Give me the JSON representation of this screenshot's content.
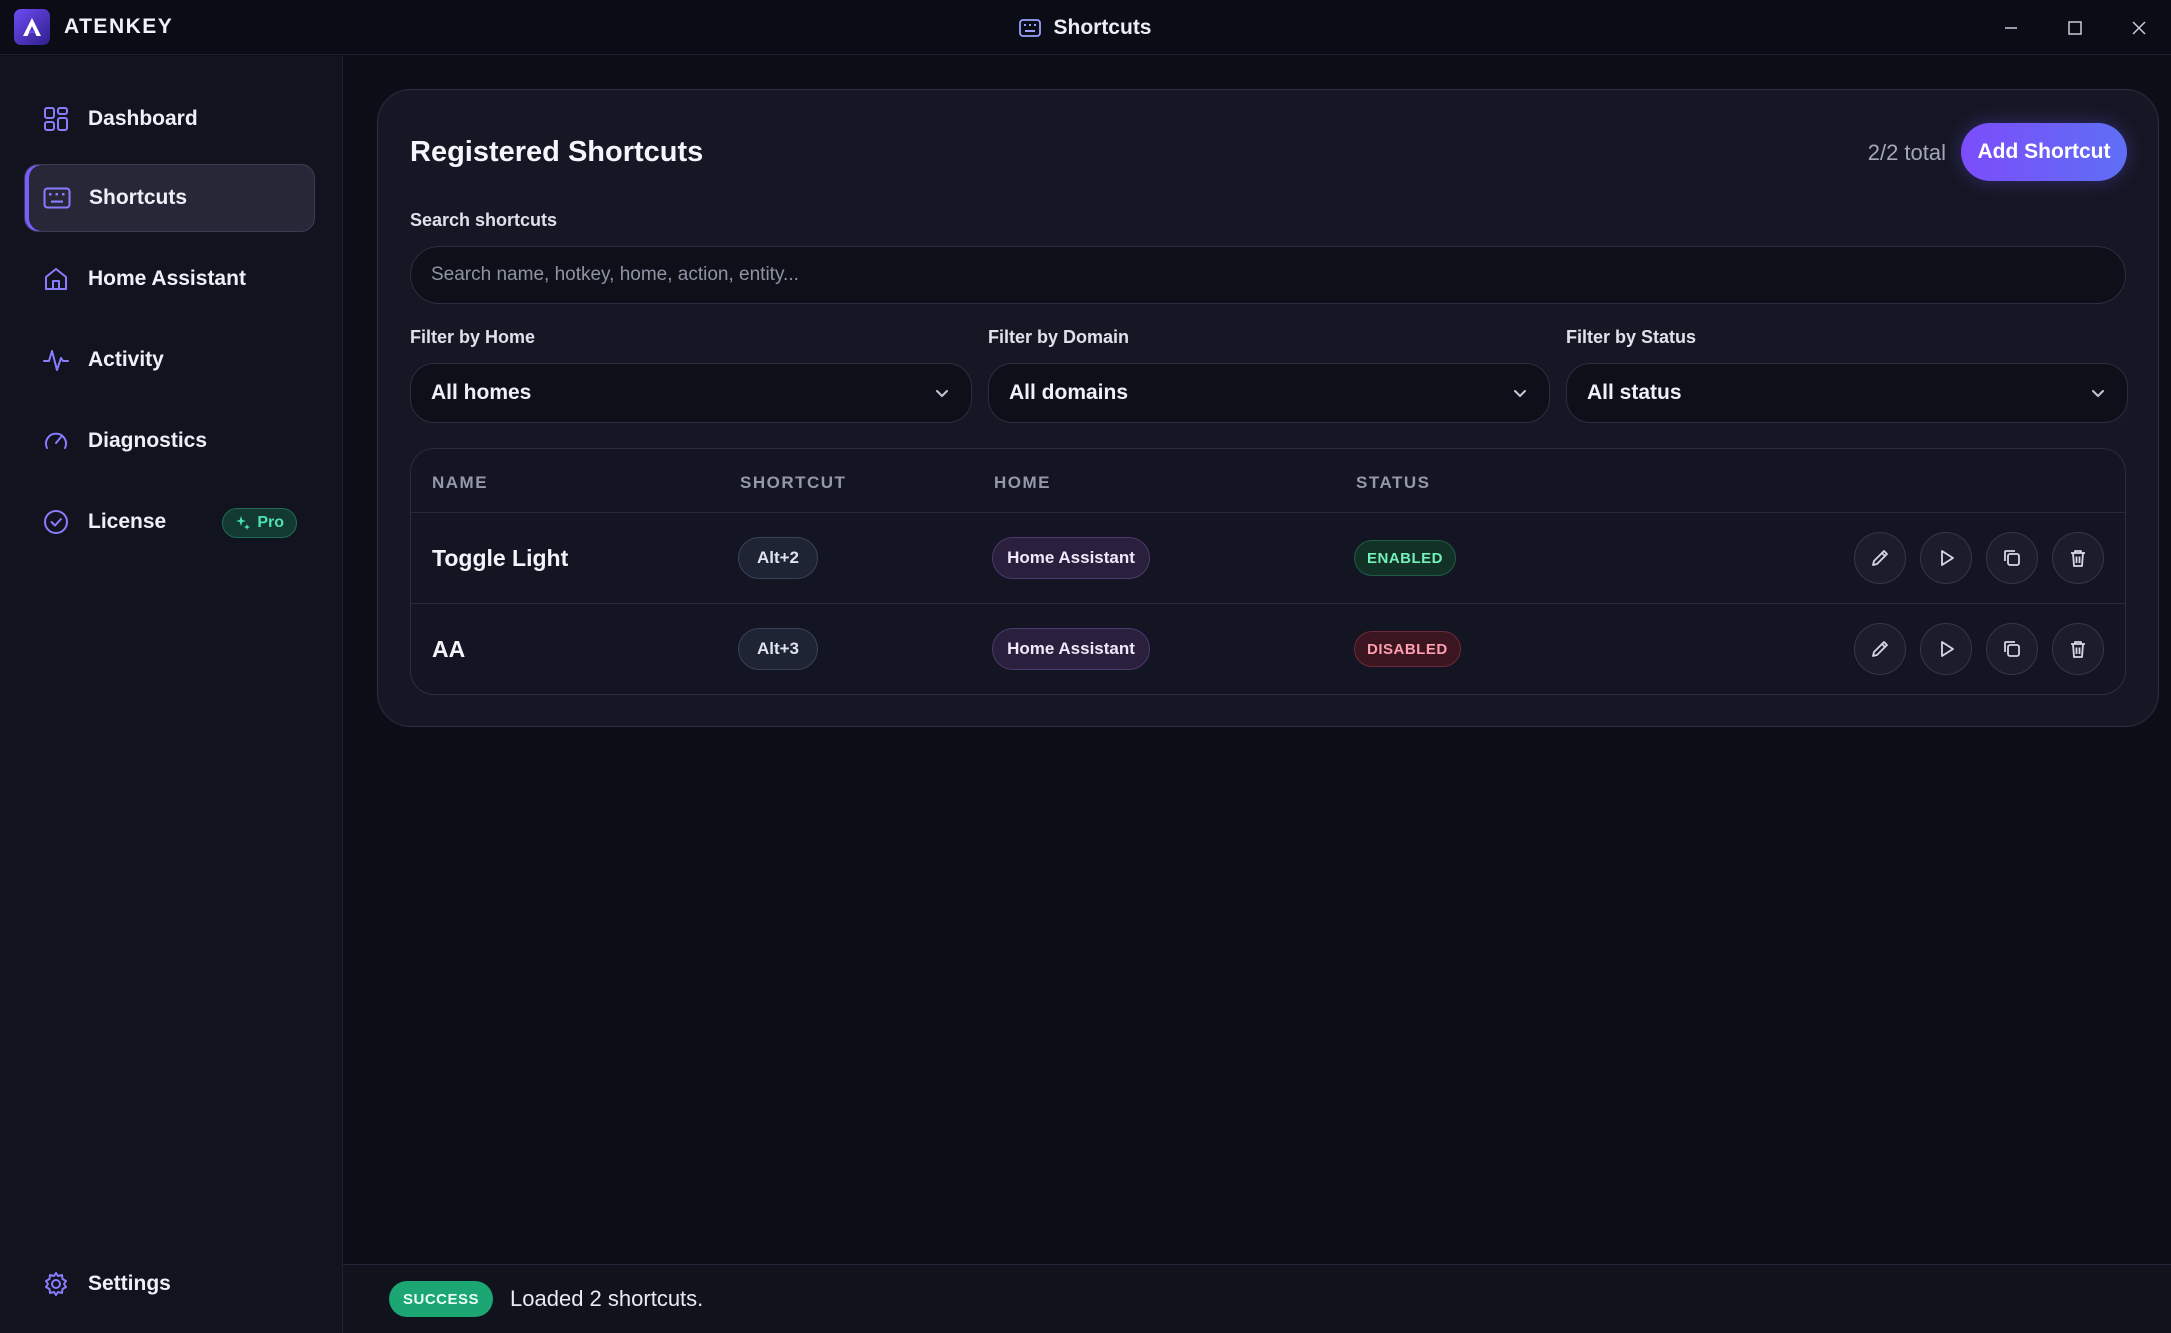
{
  "app": {
    "brand_name": "ATENKEY",
    "window_title": "Shortcuts"
  },
  "sidebar": {
    "items": [
      {
        "label": "Dashboard",
        "icon": "grid-icon"
      },
      {
        "label": "Shortcuts",
        "icon": "keyboard-icon",
        "active": true
      },
      {
        "label": "Home Assistant",
        "icon": "home-icon"
      },
      {
        "label": "Activity",
        "icon": "activity-icon"
      },
      {
        "label": "Diagnostics",
        "icon": "gauge-icon"
      },
      {
        "label": "License",
        "icon": "check-badge-icon",
        "badge": "Pro"
      }
    ],
    "settings_label": "Settings"
  },
  "main": {
    "title": "Registered Shortcuts",
    "total": "2/2 total",
    "add_button": "Add Shortcut",
    "search": {
      "label": "Search shortcuts",
      "placeholder": "Search name, hotkey, home, action, entity..."
    },
    "filters": [
      {
        "label": "Filter by Home",
        "value": "All homes"
      },
      {
        "label": "Filter by Domain",
        "value": "All domains"
      },
      {
        "label": "Filter by Status",
        "value": "All status"
      }
    ],
    "table": {
      "columns": [
        "NAME",
        "SHORTCUT",
        "HOME",
        "STATUS"
      ],
      "rows": [
        {
          "name": "Toggle Light",
          "shortcut": "Alt+2",
          "home": "Home Assistant",
          "status": "ENABLED"
        },
        {
          "name": "AA",
          "shortcut": "Alt+3",
          "home": "Home Assistant",
          "status": "DISABLED"
        }
      ]
    }
  },
  "statusbar": {
    "badge": "SUCCESS",
    "message": "Loaded 2 shortcuts."
  },
  "colors": {
    "accent": "#7b4dfa",
    "enabled": "#74f0b9",
    "disabled": "#ff9eae",
    "success": "#1ba673"
  }
}
